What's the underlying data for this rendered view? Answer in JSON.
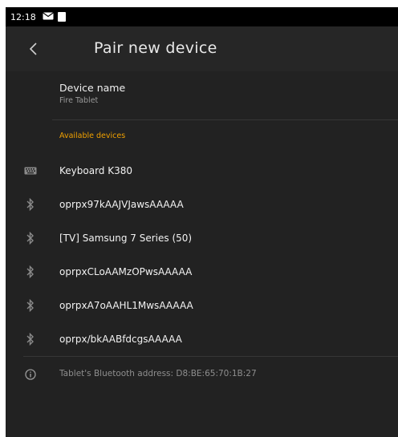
{
  "status_bar": {
    "time": "12:18",
    "icons": [
      "mail-icon",
      "notification-square-icon"
    ]
  },
  "app_bar": {
    "back_icon": "chevron-left-icon",
    "title": "Pair new device"
  },
  "device_name": {
    "title": "Device name",
    "value": "Fire Tablet"
  },
  "available_devices": {
    "header": "Available devices",
    "header_color": "#f0a000",
    "items": [
      {
        "icon": "keyboard-icon",
        "label": "Keyboard K380"
      },
      {
        "icon": "bluetooth-icon",
        "label": "oprpx97kAAJVJawsAAAAA"
      },
      {
        "icon": "bluetooth-icon",
        "label": "[TV] Samsung 7 Series (50)"
      },
      {
        "icon": "bluetooth-icon",
        "label": "oprpxCLoAAMzOPwsAAAAA"
      },
      {
        "icon": "bluetooth-icon",
        "label": "oprpxA7oAAHL1MwsAAAAA"
      },
      {
        "icon": "bluetooth-icon",
        "label": "oprpx/bkAABfdcgsAAAAA"
      }
    ]
  },
  "footer_info": {
    "icon": "info-icon",
    "text": "Tablet's Bluetooth address: D8:BE:65:70:1B:27"
  }
}
